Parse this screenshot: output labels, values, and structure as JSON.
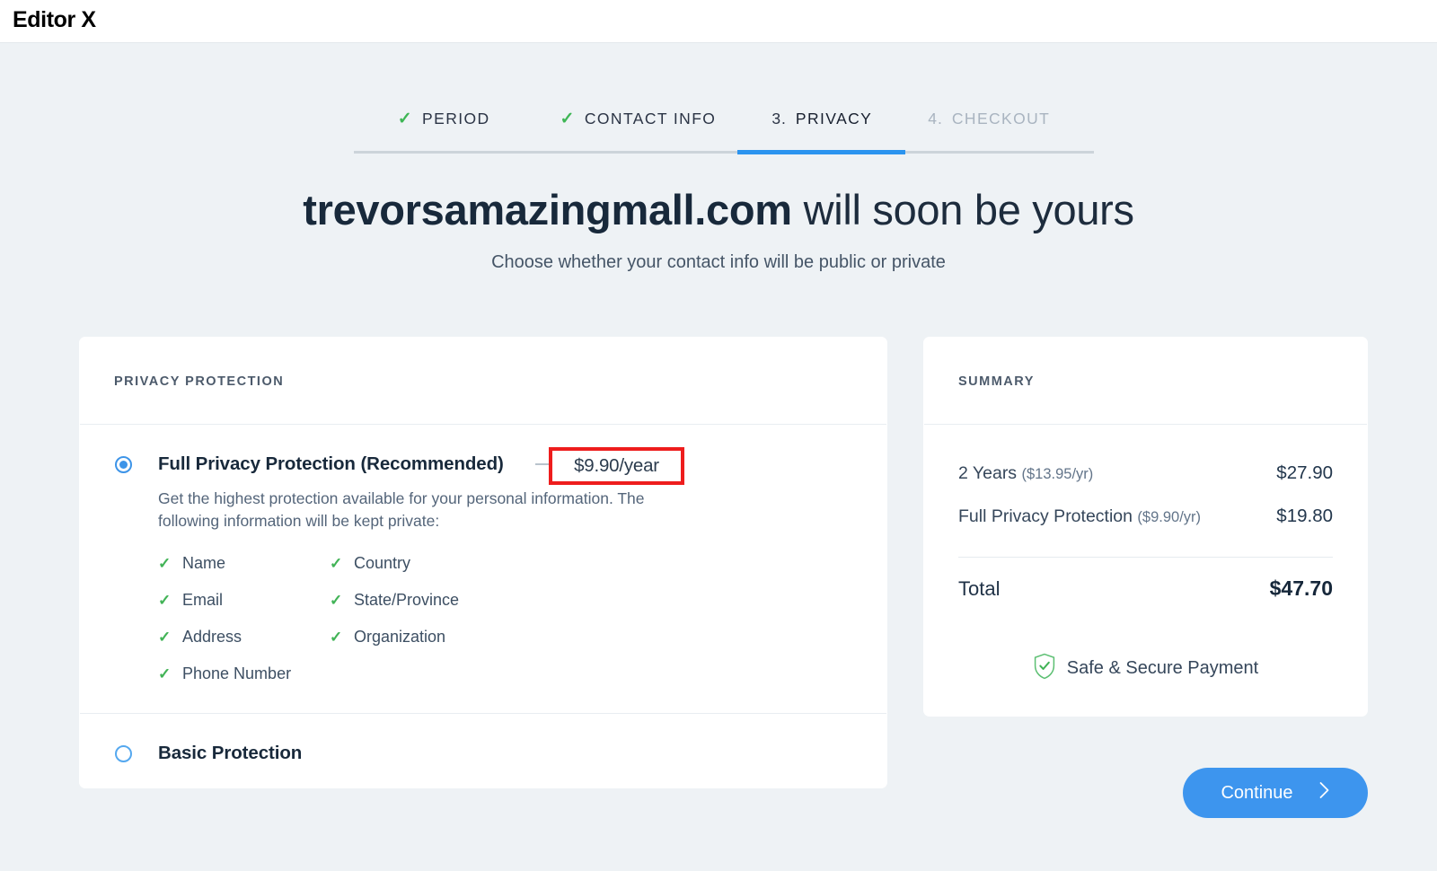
{
  "header": {
    "brand": "Editor X"
  },
  "steps": [
    {
      "num": "",
      "label": "PERIOD",
      "state": "done",
      "icon": "check-icon"
    },
    {
      "num": "",
      "label": "CONTACT INFO",
      "state": "done",
      "icon": "check-icon"
    },
    {
      "num": "3.",
      "label": "PRIVACY",
      "state": "current",
      "icon": ""
    },
    {
      "num": "4.",
      "label": "CHECKOUT",
      "state": "future",
      "icon": ""
    }
  ],
  "hero": {
    "domain": "trevorsamazingmall.com",
    "headline_rest": " will soon be yours",
    "subhead": "Choose whether your contact info will be public or private"
  },
  "privacy": {
    "card_title": "PRIVACY PROTECTION",
    "full": {
      "title": "Full Privacy Protection (Recommended)",
      "price": "$9.90/year",
      "selected": true,
      "description": "Get the highest protection available for your personal information. The following information will be kept private:",
      "features_left": [
        "Name",
        "Email",
        "Address",
        "Phone Number"
      ],
      "features_right": [
        "Country",
        "State/Province",
        "Organization"
      ]
    },
    "basic": {
      "title": "Basic Protection",
      "selected": false
    }
  },
  "summary": {
    "card_title": "SUMMARY",
    "rows": [
      {
        "label": "2 Years",
        "sub": "($13.95/yr)",
        "amount": "$27.90"
      },
      {
        "label": "Full Privacy Protection",
        "sub": "($9.90/yr)",
        "amount": "$19.80"
      }
    ],
    "total_label": "Total",
    "total_amount": "$47.70",
    "secure_text": "Safe & Secure Payment"
  },
  "actions": {
    "continue_label": "Continue"
  },
  "colors": {
    "page_bg": "#eef2f5",
    "accent_blue": "#3d95ee",
    "check_green": "#41b356",
    "highlight_red": "#ee1d1d",
    "text_dark": "#1d2c3d"
  }
}
